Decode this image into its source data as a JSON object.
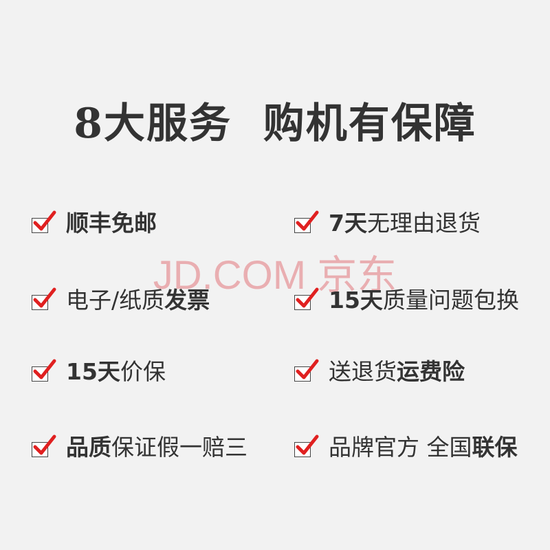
{
  "title": "8大服务  购机有保障",
  "watermark": "JD.COM 京东",
  "colors": {
    "check": "#e02020",
    "text": "#333333",
    "background": "#f2f2f2",
    "watermark": "#e8a3a6"
  },
  "icons": {
    "check": "check-mark-icon"
  },
  "services_left": [
    {
      "bold": "顺丰免邮",
      "regular": "",
      "bold2": ""
    },
    {
      "bold": "",
      "regular": "电子/纸质",
      "bold2": "发票"
    },
    {
      "bold": "15天",
      "regular": "价保",
      "bold2": ""
    },
    {
      "bold": "品质",
      "regular": "保证假一赔三",
      "bold2": ""
    }
  ],
  "services_right": [
    {
      "bold": "7天",
      "regular": "无理由退货",
      "bold2": ""
    },
    {
      "bold": "15天",
      "regular": "质量问题包换",
      "bold2": ""
    },
    {
      "bold": "",
      "regular": "送退货",
      "bold2": "运费险"
    },
    {
      "bold": "",
      "regular": "品牌官方 全国",
      "bold2": "联保"
    }
  ]
}
